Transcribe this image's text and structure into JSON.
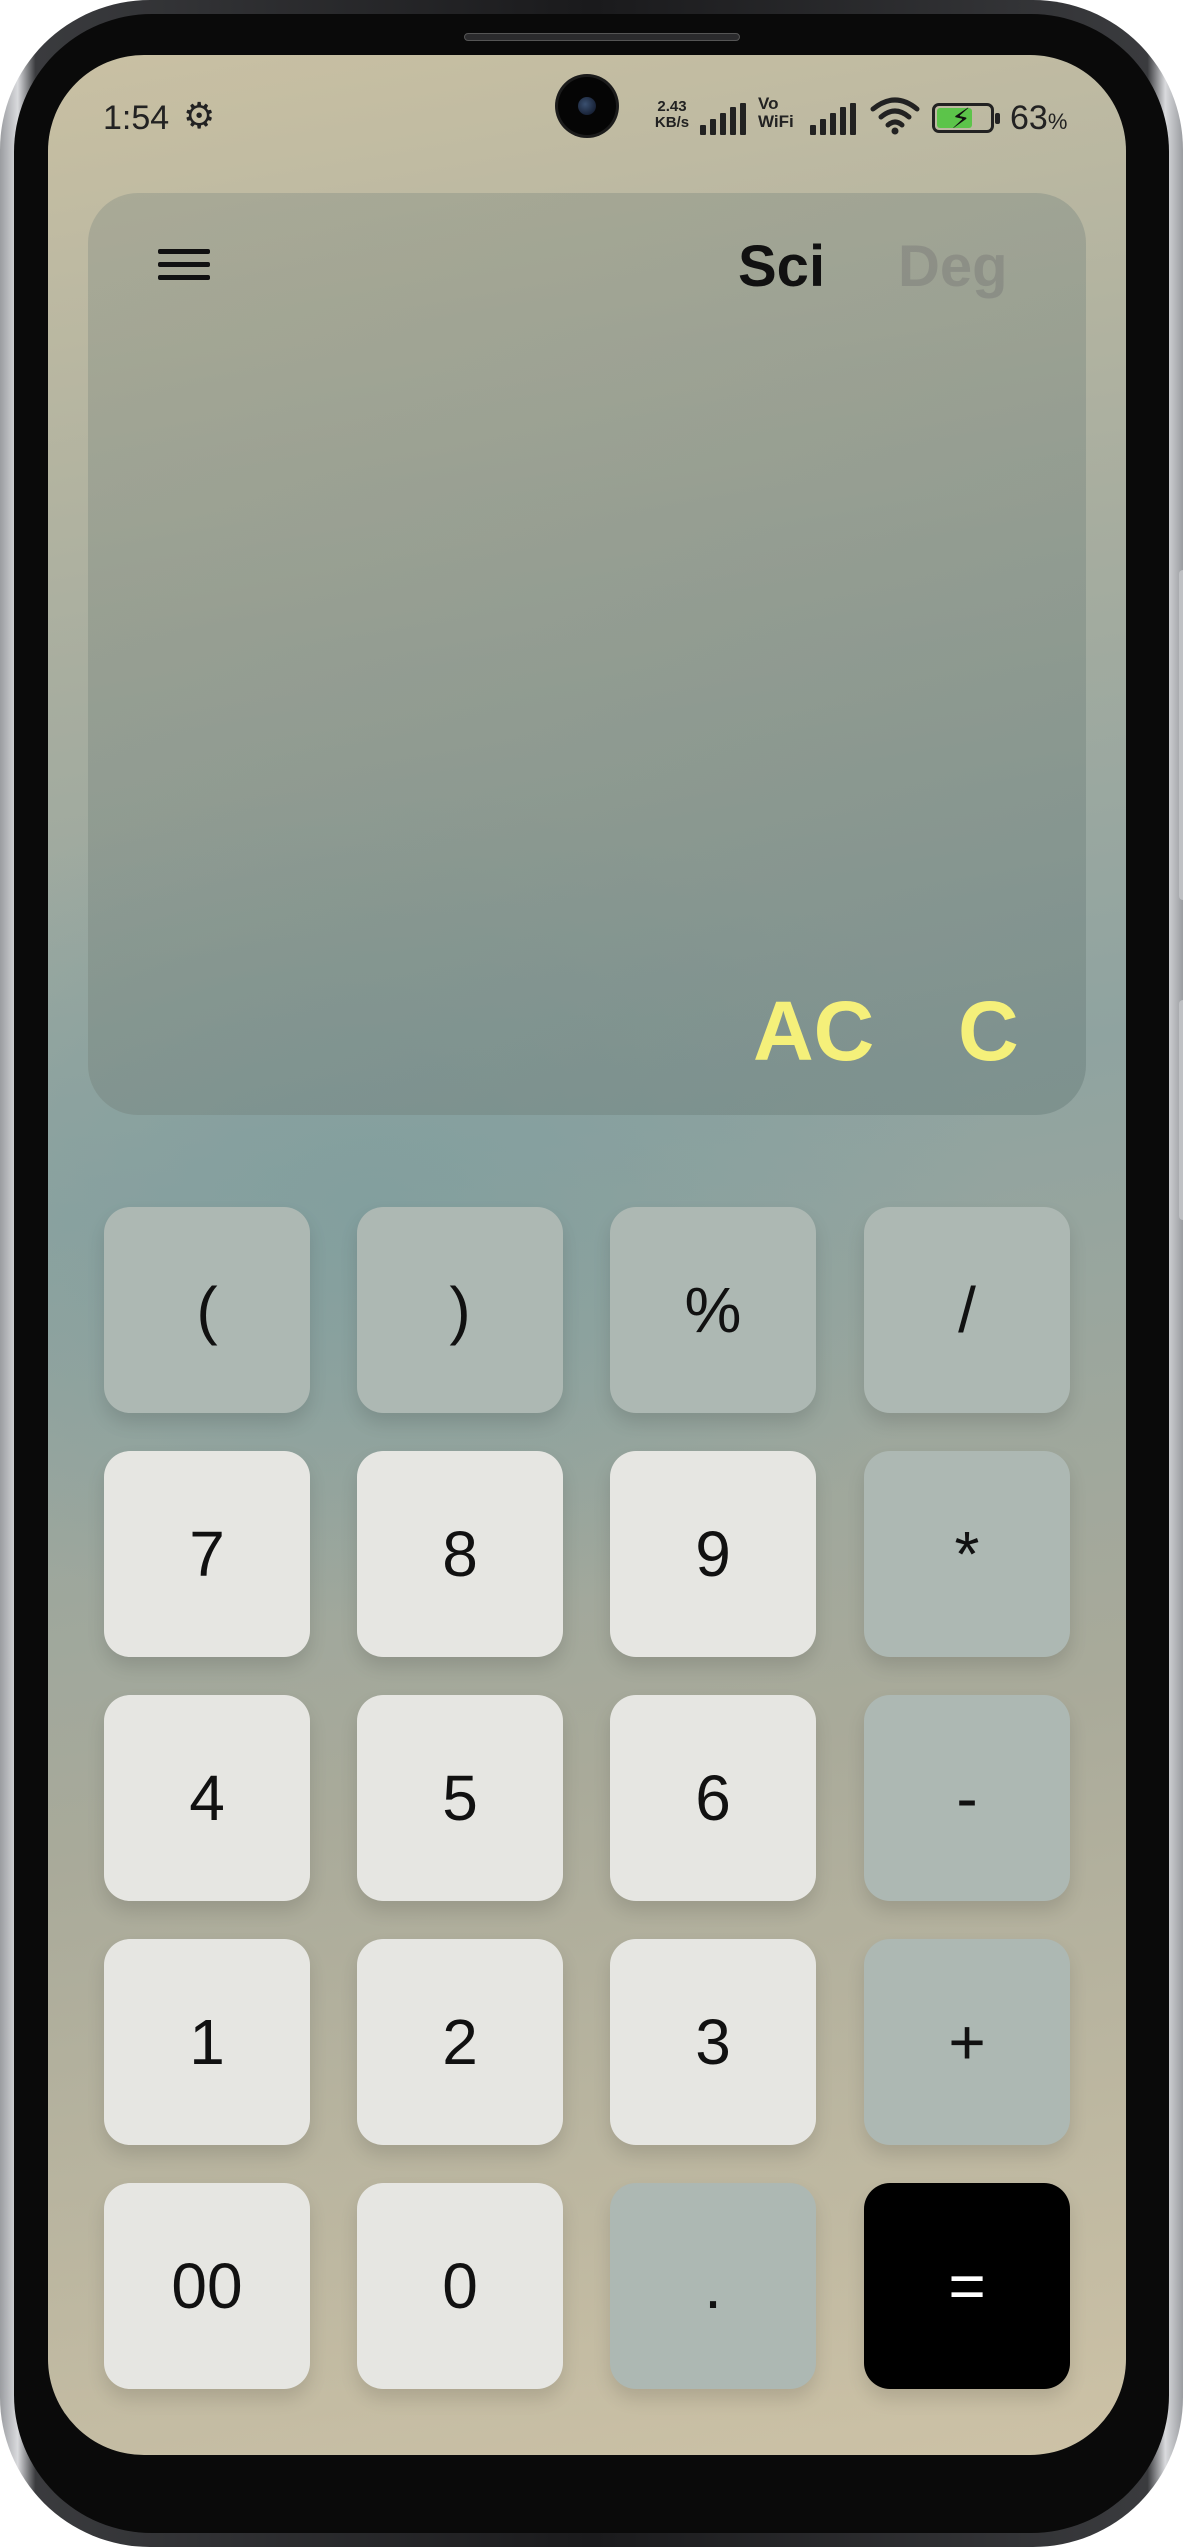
{
  "status_bar": {
    "time": "1:54",
    "settings_icon": "gear-icon",
    "net_speed_value": "2.43",
    "net_speed_unit": "KB/s",
    "volte_top": "Vo",
    "volte_bottom": "WiFi",
    "battery_percent": "63",
    "battery_percent_sign": "%",
    "battery_level": 0.63,
    "battery_color": "#5cc44a"
  },
  "display": {
    "menu_icon": "hamburger-menu-icon",
    "mode_sci": "Sci",
    "mode_deg": "Deg",
    "clear_all": "AC",
    "clear": "C",
    "accent_color": "#f5f07a"
  },
  "keypad": {
    "open_paren": "(",
    "close_paren": ")",
    "percent": "%",
    "divide": "/",
    "seven": "7",
    "eight": "8",
    "nine": "9",
    "multiply": "*",
    "four": "4",
    "five": "5",
    "six": "6",
    "minus": "-",
    "one": "1",
    "two": "2",
    "three": "3",
    "plus": "+",
    "double_zero": "00",
    "zero": "0",
    "decimal": ".",
    "equals": "="
  }
}
